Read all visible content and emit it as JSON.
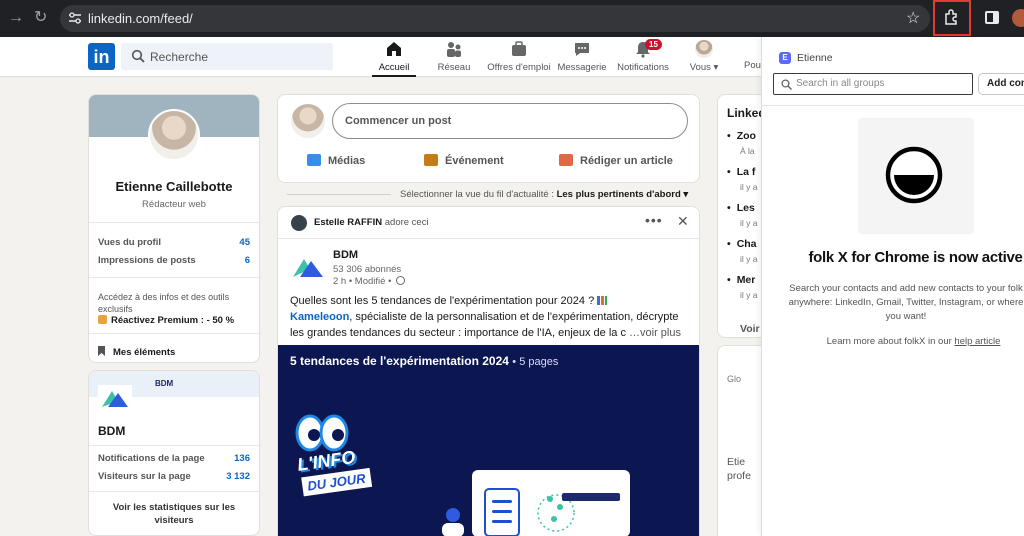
{
  "browser": {
    "url": "linkedin.com/feed/"
  },
  "header": {
    "logo": "in",
    "search_placeholder": "Recherche",
    "nav": [
      {
        "label": "Accueil",
        "icon": "home-icon",
        "active": true
      },
      {
        "label": "Réseau",
        "icon": "network-icon"
      },
      {
        "label": "Offres d'emploi",
        "icon": "jobs-icon"
      },
      {
        "label": "Messagerie",
        "icon": "messaging-icon"
      },
      {
        "label": "Notifications",
        "icon": "bell-icon",
        "badge": "15"
      },
      {
        "label": "Vous ▾",
        "icon": "avatar-icon"
      }
    ],
    "truncated_item": "Pou"
  },
  "profile": {
    "name": "Etienne Caillebotte",
    "role": "Rédacteur web",
    "stats": [
      {
        "label": "Vues du profil",
        "value": "45"
      },
      {
        "label": "Impressions de posts",
        "value": "6"
      }
    ],
    "premium_text": "Accédez à des infos et des outils exclusifs",
    "premium_link": "Réactivez Premium : - 50 %",
    "saved_items": "Mes éléments"
  },
  "page_card": {
    "banner_text": "BDM",
    "name": "BDM",
    "stats": [
      {
        "label": "Notifications de la page",
        "value": "136"
      },
      {
        "label": "Visiteurs sur la page",
        "value": "3 132"
      }
    ],
    "footer": "Voir les statistiques sur les visiteurs"
  },
  "composer": {
    "placeholder": "Commencer un post",
    "actions": [
      {
        "label": "Médias",
        "color": "#378fe9"
      },
      {
        "label": "Événement",
        "color": "#c37d16"
      },
      {
        "label": "Rédiger un article",
        "color": "#e06847"
      }
    ]
  },
  "feed_sort": {
    "label": "Sélectionner la vue du fil d'actualité :",
    "value": "Les plus pertinents d'abord ▾"
  },
  "post": {
    "actor": "Estelle RAFFIN",
    "action": "adore ceci",
    "author": "BDM",
    "followers": "53 306 abonnés",
    "meta": "2 h • Modifié •",
    "text_line1": "Quelles sont les 5 tendances de l'expérimentation pour 2024 ?",
    "text_link": "Kameleoon",
    "text_line2": ", spécialiste de la personnalisation et de l'expérimentation, décrypte les grandes tendances du secteur : importance de l'IA, enjeux de la c",
    "more": "…voir plus",
    "doc_title": "5 tendances de l'expérimentation 2024",
    "doc_pages": "• 5 pages",
    "doc_l1": "L'INFO",
    "doc_l2": "DU JOUR"
  },
  "news": {
    "title": "Linked",
    "items": [
      {
        "title": "Zoo",
        "sub": "À la"
      },
      {
        "title": "La f",
        "sub": "il y a"
      },
      {
        "title": "Les",
        "sub": "il y a"
      },
      {
        "title": "Cha",
        "sub": "il y a"
      },
      {
        "title": "Mer",
        "sub": "il y a"
      }
    ],
    "see_more": "Voir"
  },
  "ad": {
    "top": "Glo",
    "text1": "Etie",
    "text2": "profe"
  },
  "folk": {
    "workspace_initial": "E",
    "workspace": "Etienne",
    "search_placeholder": "Search in all groups",
    "add_button": "Add contact",
    "headline": "folk X for Chrome is now active",
    "desc_line1": "Search your contacts and add new contacts to your folk",
    "desc_line2": "anywhere: LinkedIn, Gmail, Twitter, Instagram, or where",
    "desc_line3": "you want!",
    "learn_prefix": "Learn more about folkX in our",
    "learn_link": "help article"
  }
}
